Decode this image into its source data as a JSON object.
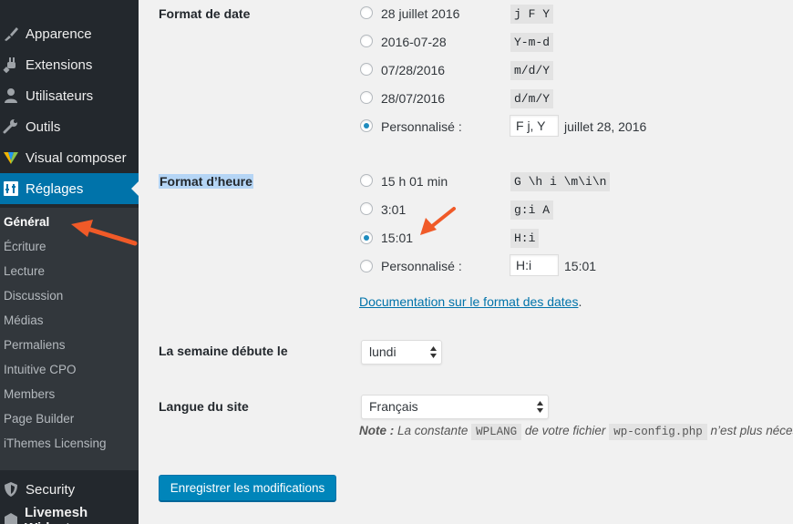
{
  "sidebar": {
    "menu": [
      {
        "label": "Apparence",
        "icon": "paintbrush-icon"
      },
      {
        "label": "Extensions",
        "icon": "plugin-icon"
      },
      {
        "label": "Utilisateurs",
        "icon": "users-icon"
      },
      {
        "label": "Outils",
        "icon": "wrench-icon"
      },
      {
        "label": "Visual composer",
        "icon": "visual-composer-icon"
      },
      {
        "label": "Réglages",
        "icon": "settings-icon",
        "current": true
      }
    ],
    "submenu": [
      {
        "label": "Général",
        "active": true
      },
      {
        "label": "Écriture"
      },
      {
        "label": "Lecture"
      },
      {
        "label": "Discussion"
      },
      {
        "label": "Médias"
      },
      {
        "label": "Permaliens"
      },
      {
        "label": "Intuitive CPO"
      },
      {
        "label": "Members"
      },
      {
        "label": "Page Builder"
      },
      {
        "label": "iThemes Licensing"
      }
    ],
    "bottom": [
      {
        "label": "Security",
        "icon": "shield-icon"
      },
      {
        "label": "Livemesh Widgets",
        "icon": "livemesh-icon"
      }
    ]
  },
  "date_format": {
    "label": "Format de date",
    "options": [
      {
        "label": "28 juillet 2016",
        "code": "j F Y",
        "checked": false
      },
      {
        "label": "2016-07-28",
        "code": "Y-m-d",
        "checked": false
      },
      {
        "label": "07/28/2016",
        "code": "m/d/Y",
        "checked": false
      },
      {
        "label": "28/07/2016",
        "code": "d/m/Y",
        "checked": false
      },
      {
        "label": "Personnalisé :",
        "input": "F j, Y",
        "preview": "juillet 28, 2016",
        "checked": true
      }
    ]
  },
  "time_format": {
    "label": "Format d’heure",
    "options": [
      {
        "label": "15 h 01 min",
        "code": "G \\h i \\m\\i\\n",
        "checked": false
      },
      {
        "label": "3:01",
        "code": "g:i A",
        "checked": false
      },
      {
        "label": "15:01",
        "code": "H:i",
        "checked": true
      },
      {
        "label": "Personnalisé :",
        "input": "H:i",
        "preview": "15:01",
        "checked": false
      }
    ],
    "doc_link": "Documentation sur le format des dates",
    "doc_link_suffix": "."
  },
  "week_start": {
    "label": "La semaine débute le",
    "selected": "lundi"
  },
  "site_language": {
    "label": "Langue du site",
    "selected": "Français",
    "note_prefix": "Note :",
    "note_part1": "La constante",
    "note_code1": "WPLANG",
    "note_part2": "de votre fichier",
    "note_code2": "wp-config.php",
    "note_part3": "n’est plus nécessaire."
  },
  "save_button": "Enregistrer les modifications",
  "colors": {
    "sidebar_bg": "#23282d",
    "submenu_bg": "#32373c",
    "accent": "#0073aa",
    "button": "#0085ba",
    "annotation_arrow": "#f05a28"
  }
}
